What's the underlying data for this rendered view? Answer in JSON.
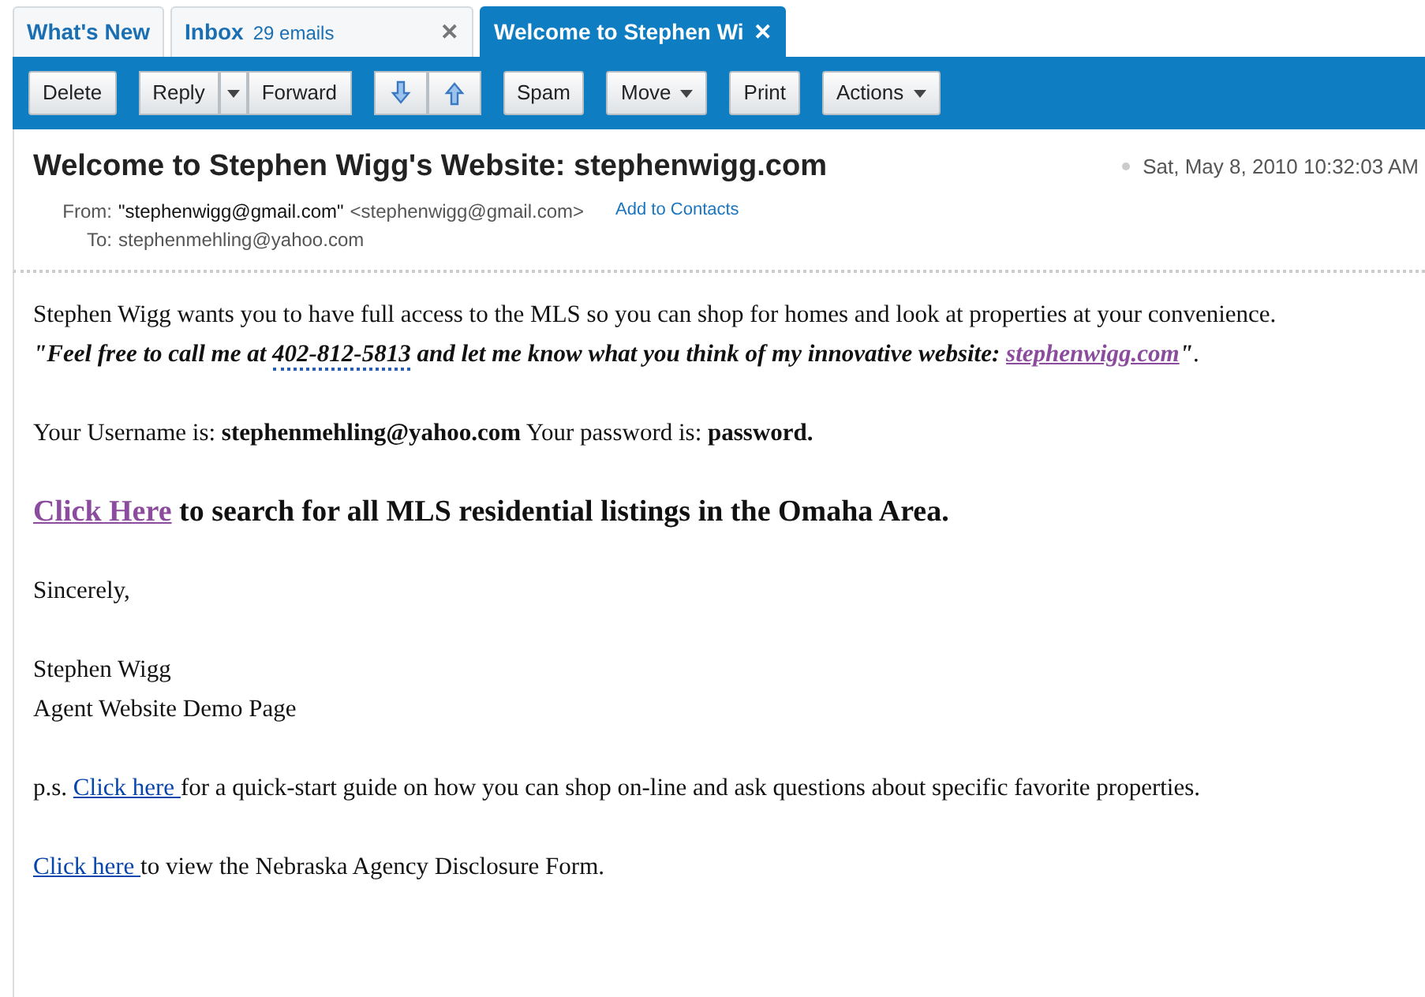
{
  "tabs": [
    {
      "label": "What's New",
      "selected": false
    },
    {
      "label": "Inbox",
      "count": "29 emails",
      "close": "✕",
      "selected": false
    },
    {
      "label": "Welcome to Stephen Wi",
      "close": "✕",
      "selected": true
    }
  ],
  "toolbar": [
    {
      "kind": "button",
      "label": "Delete"
    },
    {
      "kind": "split",
      "items": [
        {
          "kind": "button",
          "label": "Reply"
        },
        {
          "kind": "caret"
        },
        {
          "kind": "button",
          "label": "Forward"
        }
      ]
    },
    {
      "kind": "arrows",
      "items": [
        {
          "kind": "down"
        },
        {
          "kind": "up"
        }
      ]
    },
    {
      "kind": "button",
      "label": "Spam"
    },
    {
      "kind": "menu",
      "label": "Move"
    },
    {
      "kind": "button",
      "label": "Print"
    },
    {
      "kind": "menu",
      "label": "Actions"
    }
  ],
  "message": {
    "subject": "Welcome to Stephen Wigg's Website: stephenwigg.com",
    "date": "Sat, May 8, 2010 10:32:03 AM",
    "from_label": "From:",
    "from_name": "\"stephenwigg@gmail.com\"",
    "from_address": "<stephenwigg@gmail.com>",
    "add_contact": "Add to Contacts",
    "to_label": "To:",
    "to_address": "stephenmehling@yahoo.com"
  },
  "body": [
    {
      "kind": "line",
      "segments": [
        {
          "kind": "text",
          "text": "Stephen Wigg wants you to have full access to the MLS so you can shop for homes and look at properties at your convenience."
        }
      ]
    },
    {
      "kind": "paragraph",
      "segments": [
        {
          "kind": "emphasis",
          "text": "\"Feel free to call me at "
        },
        {
          "kind": "phone",
          "text": "402-812-5813"
        },
        {
          "kind": "emphasis",
          "text": " and let me know what you think of my innovative website: "
        },
        {
          "kind": "emphasis-link",
          "visited": true,
          "text": "stephenwigg.com"
        },
        {
          "kind": "emphasis",
          "text": "\""
        },
        {
          "kind": "text",
          "text": "."
        }
      ]
    },
    {
      "kind": "paragraph",
      "segments": [
        {
          "kind": "text",
          "text": "Your Username is: **stephenmehling@yahoo.com** Your password is: **password.**"
        }
      ]
    },
    {
      "kind": "headline",
      "segments": [
        {
          "kind": "link",
          "visited": true,
          "text": "Click Here"
        },
        {
          "kind": "text",
          "text": " to search for all MLS residential listings in the Omaha Area."
        }
      ]
    },
    {
      "kind": "paragraph",
      "segments": [
        {
          "kind": "text",
          "text": "Sincerely,"
        }
      ]
    },
    {
      "kind": "line",
      "segments": [
        {
          "kind": "text",
          "text": "Stephen Wigg"
        }
      ]
    },
    {
      "kind": "paragraph",
      "segments": [
        {
          "kind": "text",
          "text": "Agent Website Demo Page"
        }
      ]
    },
    {
      "kind": "paragraph",
      "segments": [
        {
          "kind": "text",
          "text": "p.s. "
        },
        {
          "kind": "link",
          "visited": false,
          "text": "Click here "
        },
        {
          "kind": "text",
          "text": "for a quick-start guide on how you can shop on-line and ask questions about specific favorite properties."
        }
      ]
    },
    {
      "kind": "paragraph",
      "segments": [
        {
          "kind": "link",
          "visited": false,
          "text": "Click here "
        },
        {
          "kind": "text",
          "text": "to view the Nebraska Agency Disclosure Form."
        }
      ]
    }
  ]
}
